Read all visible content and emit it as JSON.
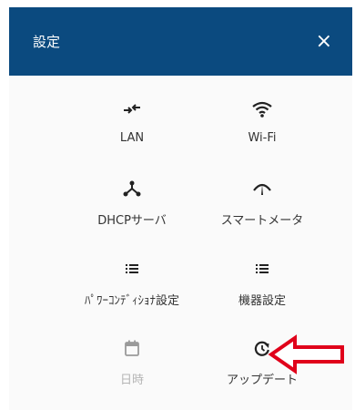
{
  "header": {
    "title": "設定",
    "close_symbol": "×",
    "background": "#0b4a7f"
  },
  "menu": {
    "items": [
      {
        "label": "LAN",
        "icon": "lan-icon",
        "enabled": true
      },
      {
        "label": "Wi-Fi",
        "icon": "wifi-icon",
        "enabled": true
      },
      {
        "label": "DHCPサーバ",
        "icon": "dhcp-server-icon",
        "enabled": true
      },
      {
        "label": "スマートメータ",
        "icon": "smart-meter-icon",
        "enabled": true
      },
      {
        "label": "ﾊﾟﾜｰｺﾝﾃﾞｨｼｮﾅ設定",
        "icon": "list-icon",
        "enabled": true
      },
      {
        "label": "機器設定",
        "icon": "list-icon",
        "enabled": true
      },
      {
        "label": "日時",
        "icon": "calendar-icon",
        "enabled": false
      },
      {
        "label": "アップデート",
        "icon": "update-icon",
        "enabled": true
      }
    ]
  },
  "annotation": {
    "arrow_color": "#e0001a"
  }
}
